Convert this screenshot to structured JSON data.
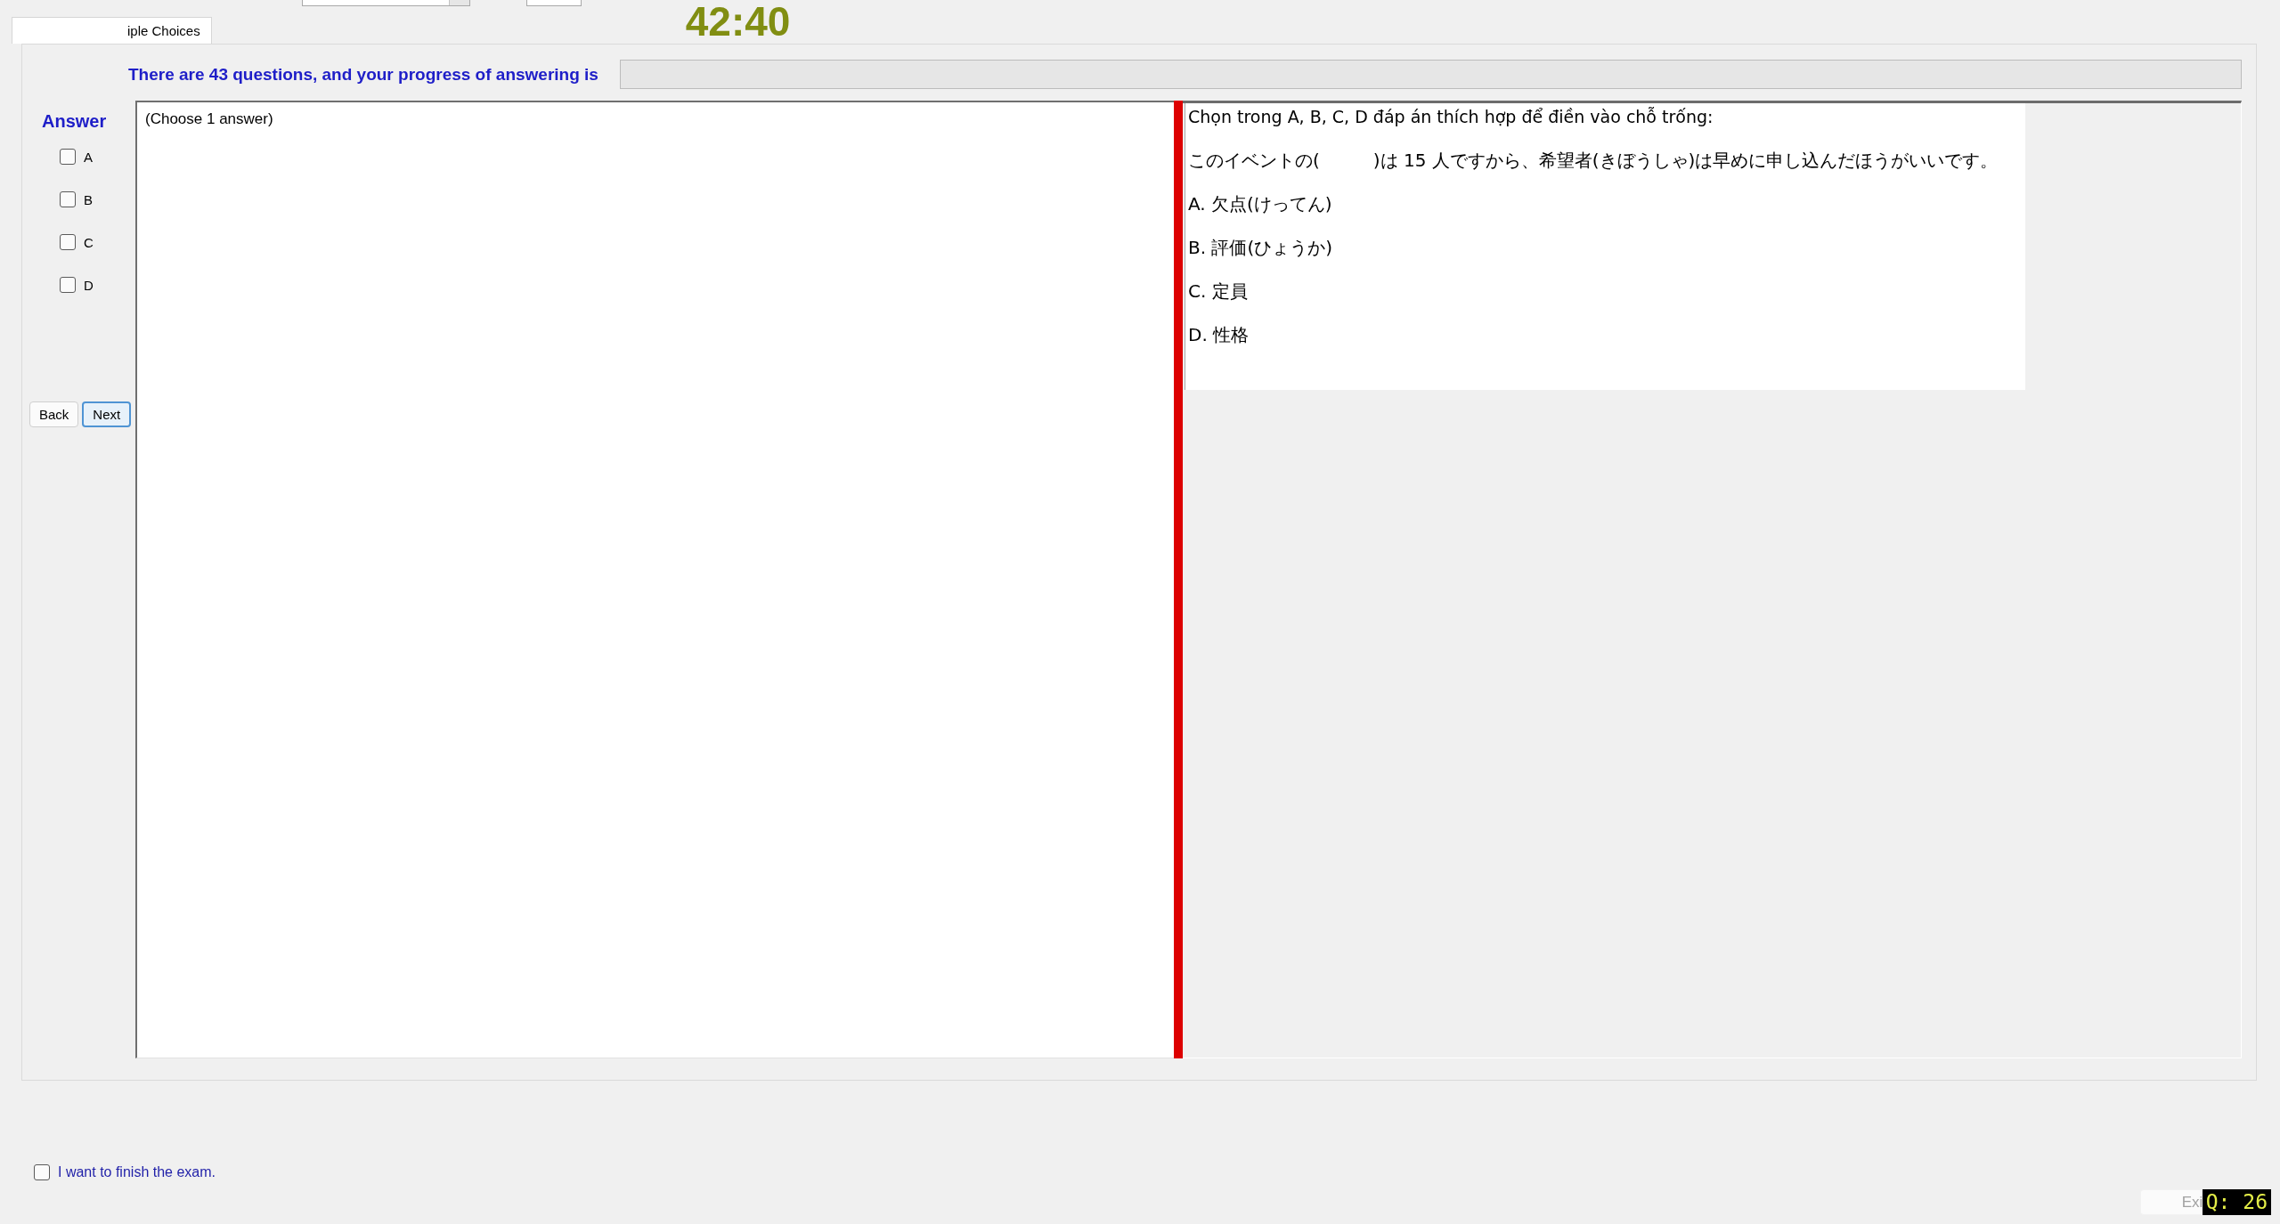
{
  "tabs": [
    {
      "label": "iple Choices",
      "selected": true
    }
  ],
  "timer": "42:40",
  "progress": {
    "label": "There are 43 questions, and your progress of answering is",
    "level": 0
  },
  "answer": {
    "title": "Answer",
    "options": [
      {
        "label": "A",
        "checked": false
      },
      {
        "label": "B",
        "checked": false
      },
      {
        "label": "C",
        "checked": false
      },
      {
        "label": "D",
        "checked": false
      }
    ]
  },
  "buttons": [
    {
      "label": "Back",
      "focused": false
    },
    {
      "label": "Next",
      "focused": true
    }
  ],
  "answer_box": {
    "text": "(Choose 1 answer)"
  },
  "question": {
    "instruction": "Chọn trong A, B, C, D đáp án thích hợp để điền vào chỗ trống:",
    "stem": "このイベントの(　　　)は 15 人ですから、希望者(きぼうしゃ)は早めに申し込んだほうがいいです。",
    "choices": [
      "A. 欠点(けってん)",
      "B. 評価(ひょうか)",
      "C. 定員",
      "D. 性格"
    ]
  },
  "finish": {
    "label": "I want to finish the exam.",
    "checked": false
  },
  "exit_button": {
    "label": "Exi",
    "disabled": true
  },
  "question_badge": "Q: 26"
}
